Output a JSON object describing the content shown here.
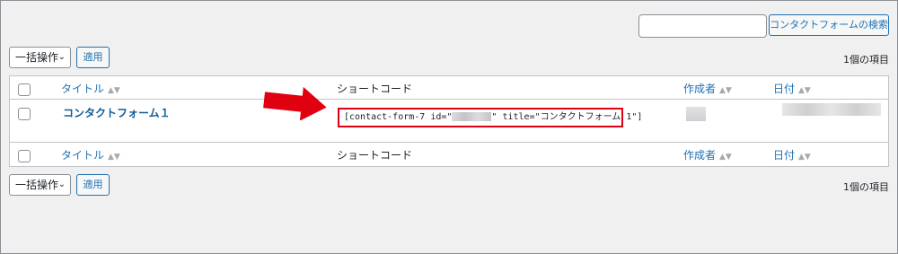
{
  "search": {
    "placeholder": "",
    "button_label": "コンタクトフォームの検索"
  },
  "bulk_actions": {
    "label": "一括操作",
    "apply_label": "適用"
  },
  "item_count": "1個の項目",
  "columns": {
    "title": "タイトル",
    "shortcode": "ショートコード",
    "author": "作成者",
    "date": "日付"
  },
  "rows": [
    {
      "title": "コンタクトフォーム１",
      "shortcode_prefix": "[contact-form-7 id=\"",
      "shortcode_suffix": "\" title=\"コンタクトフォーム 1\"]"
    }
  ],
  "colors": {
    "accent": "#2271b1",
    "highlight": "#e00010"
  }
}
